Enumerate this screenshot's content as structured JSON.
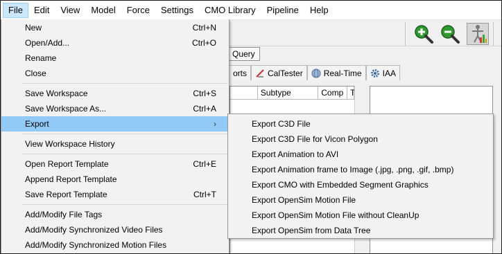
{
  "menubar": {
    "items": [
      "File",
      "Edit",
      "View",
      "Model",
      "Force",
      "Settings",
      "CMO Library",
      "Pipeline",
      "Help"
    ]
  },
  "background": {
    "tab_query": "Query",
    "tabs": [
      "orts",
      "CalTester",
      "Real-Time",
      "IAA"
    ],
    "table_headers": [
      "Subtype",
      "Comp",
      "T"
    ],
    "toolbar_icons": [
      "zoom-in-icon",
      "zoom-out-icon",
      "skeleton-icon"
    ]
  },
  "file_menu": {
    "new": {
      "label": "New",
      "shortcut": "Ctrl+N"
    },
    "open": {
      "label": "Open/Add...",
      "shortcut": "Ctrl+O"
    },
    "rename": {
      "label": "Rename"
    },
    "close": {
      "label": "Close"
    },
    "save_ws": {
      "label": "Save Workspace",
      "shortcut": "Ctrl+S"
    },
    "save_ws_as": {
      "label": "Save Workspace As...",
      "shortcut": "Ctrl+A"
    },
    "export": {
      "label": "Export",
      "arrow": "›"
    },
    "view_history": {
      "label": "View Workspace History"
    },
    "open_report": {
      "label": "Open Report Template",
      "shortcut": "Ctrl+E"
    },
    "append_report": {
      "label": "Append Report Template"
    },
    "save_report": {
      "label": "Save Report Template",
      "shortcut": "Ctrl+T"
    },
    "file_tags": {
      "label": "Add/Modify File Tags"
    },
    "sync_video": {
      "label": "Add/Modify Synchronized Video Files"
    },
    "sync_motion": {
      "label": "Add/Modify Synchronized Motion Files"
    }
  },
  "export_submenu": {
    "items": [
      "Export C3D File",
      "Export C3D File for Vicon Polygon",
      "Export Animation to AVI",
      "Export Animation frame to Image (.jpg, .png, .gif, .bmp)",
      "Export CMO with Embedded Segment Graphics",
      "Export OpenSim Motion File",
      "Export OpenSim Motion File without CleanUp",
      "Export OpenSim from Data Tree"
    ]
  },
  "colors": {
    "menu_highlight": "#91c9f7",
    "menubar_open": "#cce8ff",
    "zoom_green": "#2e9a2e"
  }
}
